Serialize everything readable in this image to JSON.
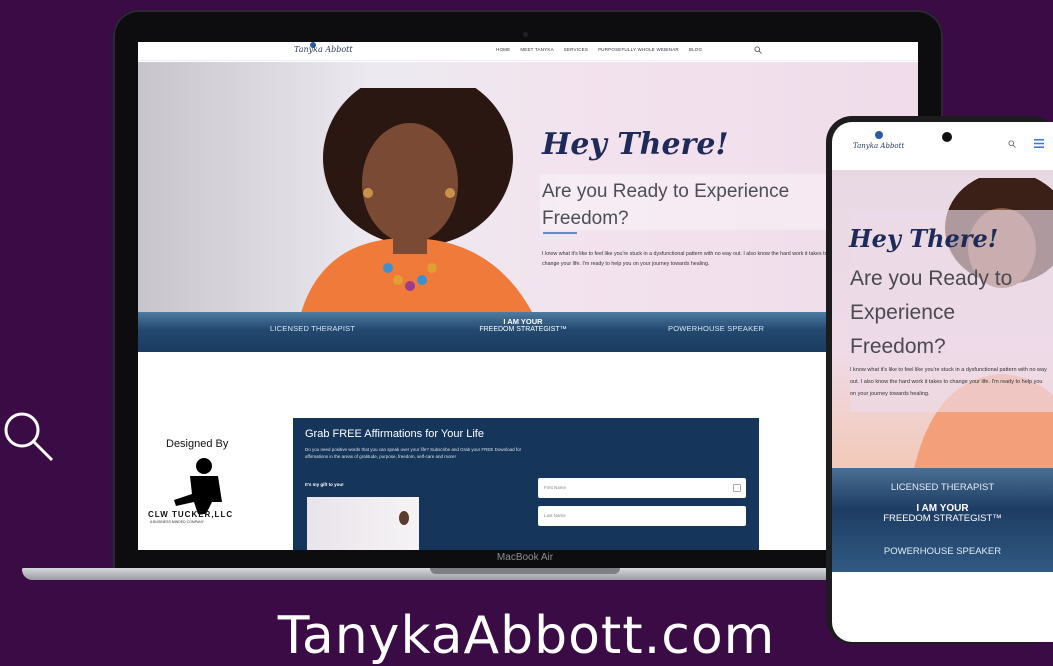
{
  "laptop": {
    "label": "MacBook Air",
    "nav": {
      "logo": "Tanyka Abbott",
      "links": [
        "HOME",
        "MEET TANYKA",
        "SERVICES",
        "PURPOSEFULLY WHOLE WEBINAR",
        "BLOG"
      ]
    },
    "hero": {
      "greeting": "Hey There!",
      "headline": "Are you Ready to Experience Freedom?",
      "body": "I know what it's like to feel like you're stuck in a dysfunctional pattern with no way out. I also know the hard work it takes to change your life. I'm ready to help you on your journey towards healing."
    },
    "strip": {
      "left": "LICENSED THERAPIST",
      "center_top": "I AM YOUR",
      "center_bottom": "FREEDOM STRATEGIST™",
      "right": "POWERHOUSE SPEAKER"
    },
    "designer": {
      "label": "Designed By",
      "name": "CLW TUCKER,LLC",
      "sub": "A BUSINESS MINDED COMPANY"
    },
    "optin": {
      "title": "Grab FREE Affirmations for Your Life",
      "text": "Do you need positive words that you can speak over your life? Subscribe and Grab your FREE Download for affirmations in the areas of gratitude, purpose, freedom, self-care and more!",
      "gift": "It's my gift to you!",
      "first_name_placeholder": "First Name",
      "last_name_placeholder": "Last Name"
    }
  },
  "phone": {
    "logo": "Tanyka Abbott",
    "greeting": "Hey There!",
    "headline": "Are you Ready to Experience Freedom?",
    "body": "I know what it's like to feel like you're stuck in a dysfunctional pattern with no way out. I also know the hard work it takes to change your life. I'm ready to help you on your journey towards healing.",
    "strip": {
      "top": "LICENSED THERAPIST",
      "center_top": "I AM YOUR",
      "center_bottom": "FREEDOM STRATEGIST™",
      "bottom": "POWERHOUSE SPEAKER"
    }
  },
  "caption": "TanykaAbbott.com",
  "colors": {
    "background": "#3a0b45",
    "navy": "#15365a",
    "heading": "#1e2a57"
  },
  "icons": [
    "search-icon",
    "menu-icon"
  ]
}
